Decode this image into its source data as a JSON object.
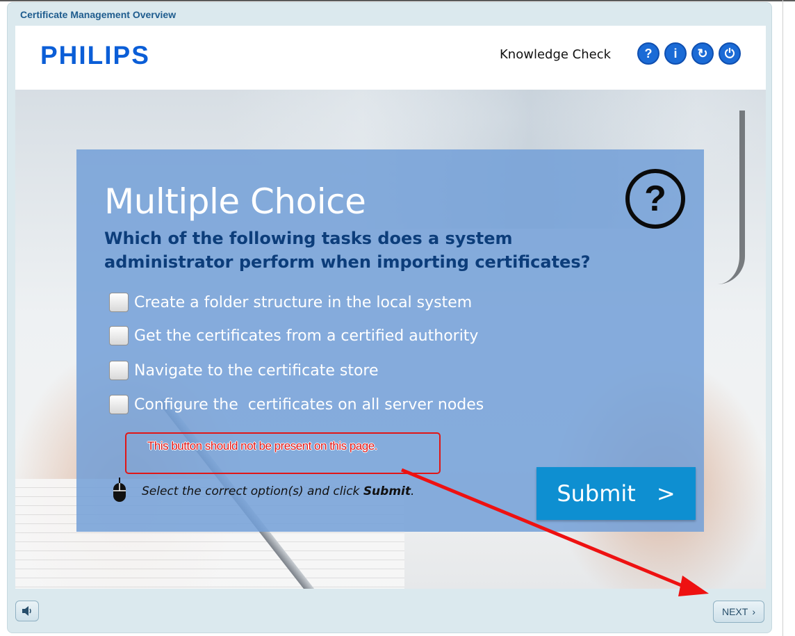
{
  "window": {
    "title": "Certificate Management Overview"
  },
  "header": {
    "logo": "PHILIPS",
    "section_label": "Knowledge Check",
    "buttons": [
      {
        "icon": "help-icon",
        "glyph": "?"
      },
      {
        "icon": "info-icon",
        "glyph": "i"
      },
      {
        "icon": "refresh-icon",
        "glyph": "↻"
      },
      {
        "icon": "power-icon",
        "glyph": "⏻"
      }
    ]
  },
  "question": {
    "type_title": "Multiple Choice",
    "text": "Which of the following tasks does a system administrator perform when importing certificates?",
    "icon": "question-circle-icon",
    "icon_glyph": "?",
    "options": [
      {
        "label": "Create a folder structure in the local system",
        "checked": false
      },
      {
        "label": "Get the certificates from a certified authority",
        "checked": false
      },
      {
        "label": "Navigate to the certificate store",
        "checked": false
      },
      {
        "label": "Configure the  certificates on all server nodes",
        "checked": false
      }
    ],
    "hint_prefix": "Select the correct option(s) and click ",
    "hint_bold": "Submit",
    "hint_suffix": ".",
    "submit_label": "Submit",
    "submit_chevron": ">"
  },
  "annotation": {
    "text": "This button should not be present on this page.",
    "color": "#e01616"
  },
  "footer": {
    "audio_icon": "speaker-icon",
    "next_label": "NEXT",
    "next_chevron": "›"
  },
  "colors": {
    "brand_blue": "#0b5ed7",
    "panel": "#73a0d7",
    "question_text": "#0c3d7a",
    "submit": "#0e8fd1"
  }
}
